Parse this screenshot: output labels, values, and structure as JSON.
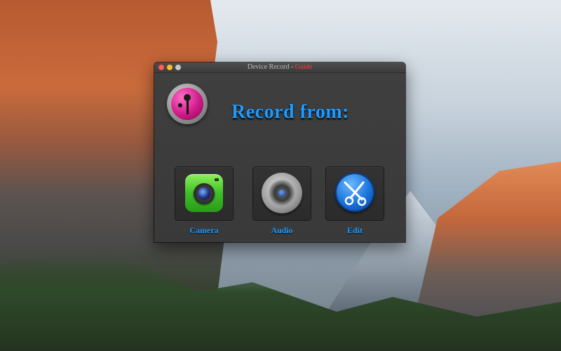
{
  "window": {
    "title_main": "Device Record - ",
    "title_accent": "Guide"
  },
  "main": {
    "heading": "Record from:"
  },
  "options": [
    {
      "label": "Camera",
      "icon": "camera-icon"
    },
    {
      "label": "Audio",
      "icon": "speaker-icon"
    },
    {
      "label": "Edit",
      "icon": "scissors-icon"
    }
  ],
  "colors": {
    "accent_blue": "#1e9bff",
    "title_accent_red": "#ff3b3b",
    "window_bg": "#3a3a3a"
  }
}
